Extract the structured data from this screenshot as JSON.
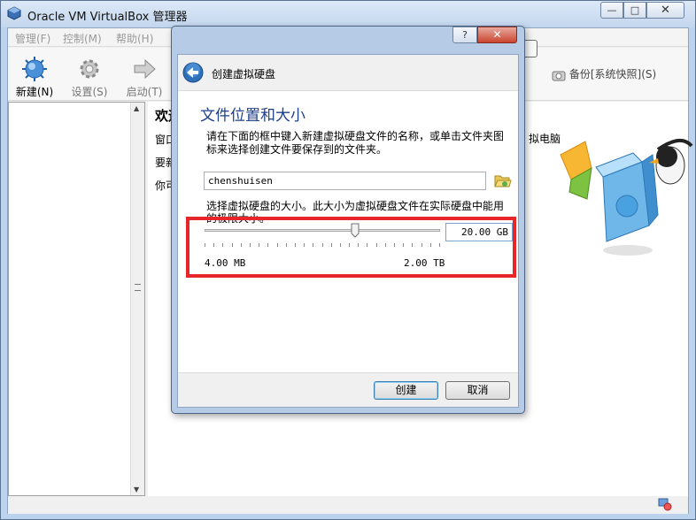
{
  "main_window": {
    "title": "Oracle VM VirtualBox 管理器",
    "controls": {
      "minimize": "—",
      "maximize": "□",
      "close": "✕"
    }
  },
  "menubar": {
    "items": [
      "管理(F)",
      "控制(M)",
      "帮助(H)"
    ]
  },
  "toolbar": {
    "new_label": "新建(N)",
    "settings_label": "设置(S)",
    "start_label": "启动(T)",
    "snapshot_label": "备份[系统快照](S)"
  },
  "welcome": {
    "title_partial": "欢迎",
    "line1_partial": "窗口",
    "line2_partial": "要新",
    "line3_partial": "你可",
    "right_fragment": "拟电脑"
  },
  "dialog": {
    "controls": {
      "help": "?",
      "close": "✕"
    },
    "title": "创建虚拟硬盘",
    "section_heading": "文件位置和大小",
    "instruction_line1": "请在下面的框中键入新建虚拟硬盘文件的名称，或单击文件夹图",
    "instruction_line2": "标来选择创建文件要保存到的文件夹。",
    "filename_value": "chenshuisen",
    "size_prompt_line1": "选择虚拟硬盘的大小。此大小为虚拟硬盘文件在实际硬盘中能用",
    "size_prompt_line2": "的极限大小。",
    "size_value": "20.00 GB",
    "slider_position": 0.64,
    "min_label": "4.00 MB",
    "max_label": "2.00 TB",
    "create_label": "创建",
    "cancel_label": "取消"
  },
  "colors": {
    "highlight": "#e8262a",
    "heading_blue": "#1e3f8a",
    "title_bar": "#c3d6ee"
  }
}
